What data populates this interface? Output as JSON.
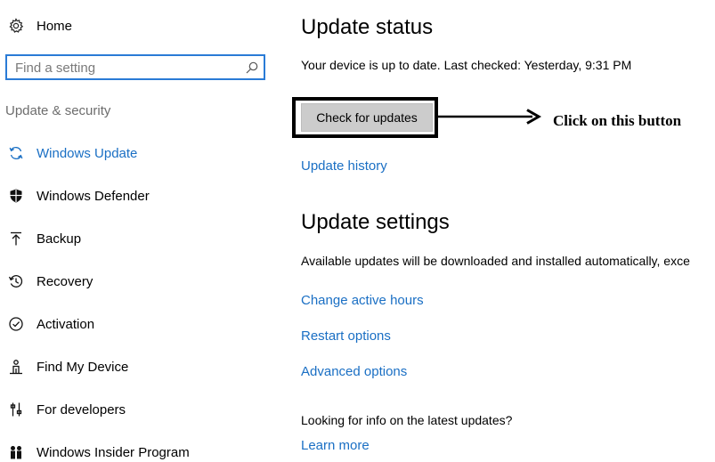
{
  "sidebar": {
    "home_label": "Home",
    "search_placeholder": "Find a setting",
    "section_label": "Update & security",
    "items": [
      {
        "label": "Windows Update",
        "icon": "sync-icon",
        "active": true
      },
      {
        "label": "Windows Defender",
        "icon": "shield-icon"
      },
      {
        "label": "Backup",
        "icon": "backup-arrow-icon"
      },
      {
        "label": "Recovery",
        "icon": "history-icon"
      },
      {
        "label": "Activation",
        "icon": "check-circle-icon"
      },
      {
        "label": "Find My Device",
        "icon": "person-locate-icon"
      },
      {
        "label": "For developers",
        "icon": "sliders-icon"
      },
      {
        "label": "Windows Insider Program",
        "icon": "insider-icon"
      }
    ]
  },
  "main": {
    "update_status_title": "Update status",
    "status_text": "Your device is up to date. Last checked: Yesterday, 9:31 PM",
    "check_button_label": "Check for updates",
    "annotation_text": "Click on this button",
    "update_history_link": "Update history",
    "update_settings_title": "Update settings",
    "auto_text": "Available updates will be downloaded and installed automatically, exce",
    "links": [
      "Change active hours",
      "Restart options",
      "Advanced options"
    ],
    "info_text": "Looking for info on the latest updates?",
    "learn_more_link": "Learn more"
  },
  "colors": {
    "accent": "#1a6fc4",
    "search_border": "#2a7bd6",
    "button_bg": "#cccccc"
  }
}
